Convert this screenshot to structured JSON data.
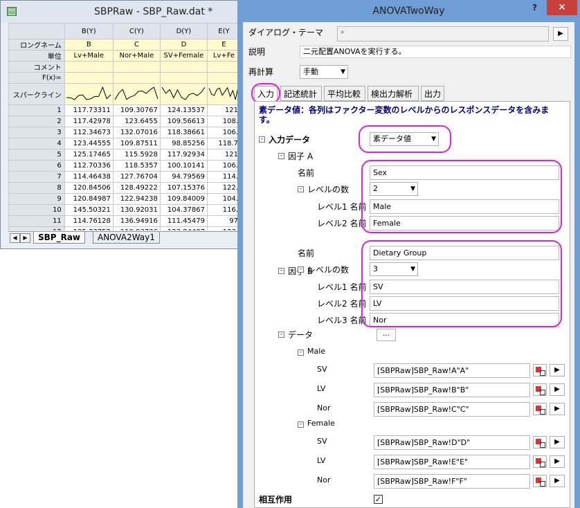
{
  "worksheet": {
    "title": "SBPRaw - SBP_Raw.dat *",
    "columns": [
      "B(Y)",
      "C(Y)",
      "D(Y)",
      "E(Y"
    ],
    "meta_labels": [
      "ロングネーム",
      "単位",
      "コメント",
      "F(x)=",
      "スパークライン"
    ],
    "long_names": [
      "B",
      "C",
      "D",
      "E"
    ],
    "units": [
      "Lv+Male",
      "Nor+Male",
      "SV+Female",
      "Lv+Fe"
    ],
    "rows": [
      {
        "n": "1",
        "v": [
          "117.73311",
          "109.30767",
          "124.13537",
          "121"
        ]
      },
      {
        "n": "2",
        "v": [
          "117.42978",
          "123.6455",
          "109.56613",
          "108."
        ]
      },
      {
        "n": "3",
        "v": [
          "112.34673",
          "132.07016",
          "118.38661",
          "106."
        ]
      },
      {
        "n": "4",
        "v": [
          "123.44555",
          "109.87511",
          "98.85256",
          "118.7"
        ]
      },
      {
        "n": "5",
        "v": [
          "125.17465",
          "115.5928",
          "117.92934",
          "121"
        ]
      },
      {
        "n": "6",
        "v": [
          "112.70336",
          "118.5357",
          "100.10141",
          "106."
        ]
      },
      {
        "n": "7",
        "v": [
          "114.46438",
          "127.76704",
          "94.79569",
          "114."
        ]
      },
      {
        "n": "8",
        "v": [
          "120.84506",
          "128.49222",
          "107.15376",
          "122."
        ]
      },
      {
        "n": "9",
        "v": [
          "120.84987",
          "122.94238",
          "109.84009",
          "104."
        ]
      },
      {
        "n": "10",
        "v": [
          "145.50321",
          "130.92031",
          "104.37867",
          "116."
        ]
      },
      {
        "n": "11",
        "v": [
          "114.76128",
          "136.94916",
          "111.45479",
          "97"
        ]
      },
      {
        "n": "12",
        "v": [
          "125.33752",
          "110.93736",
          "123.84407",
          "123."
        ]
      }
    ],
    "sheet_tabs": [
      "SBP_Raw",
      "ANOVA2Way1"
    ],
    "nav_buttons": [
      "◀",
      "▶"
    ]
  },
  "dialog": {
    "title": "ANOVATwoWay",
    "help": "?",
    "close": "✕",
    "theme_label": "ダイアログ・テーマ",
    "theme_value": "*",
    "theme_arrow": "▶",
    "desc_label": "説明",
    "desc_value": "二元配置ANOVAを実行する。",
    "recalc_label": "再計算",
    "recalc_value": "手動",
    "tabs": [
      "入力",
      "記述統計",
      "平均比較",
      "検出力解析",
      "出力"
    ],
    "info_text": "素データ値：各列はファクター変数のレベルからのレスポンスデータを含みます。",
    "input_data_label": "入力データ",
    "input_data_value": "素データ値",
    "factorA": {
      "label": "因子 A",
      "name_label": "名前",
      "name_value": "Sex",
      "levels_label": "レベルの数",
      "levels_value": "2",
      "level_names": [
        {
          "label": "レベル1 名前",
          "value": "Male"
        },
        {
          "label": "レベル2 名前",
          "value": "Female"
        }
      ]
    },
    "factorB": {
      "label": "因子 B",
      "name_label": "名前",
      "name_value": "Dietary Group",
      "levels_label": "レベルの数",
      "levels_value": "3",
      "level_names": [
        {
          "label": "レベル1 名前",
          "value": "SV"
        },
        {
          "label": "レベル2 名前",
          "value": "LV"
        },
        {
          "label": "レベル3 名前",
          "value": "Nor"
        }
      ]
    },
    "data_label": "データ",
    "data_button": "...",
    "groups": [
      {
        "label": "Male",
        "items": [
          {
            "label": "SV",
            "value": "[SBPRaw]SBP_Raw!A\"A\""
          },
          {
            "label": "LV",
            "value": "[SBPRaw]SBP_Raw!B\"B\""
          },
          {
            "label": "Nor",
            "value": "[SBPRaw]SBP_Raw!C\"C\""
          }
        ]
      },
      {
        "label": "Female",
        "items": [
          {
            "label": "SV",
            "value": "[SBPRaw]SBP_Raw!D\"D\""
          },
          {
            "label": "LV",
            "value": "[SBPRaw]SBP_Raw!E\"E\""
          },
          {
            "label": "Nor",
            "value": "[SBPRaw]SBP_Raw!F\"F\""
          }
        ]
      }
    ],
    "interaction_label": "相互作用",
    "interaction_checked": "✓",
    "colors": {
      "highlight": "#e020e0",
      "title_bg": "#6f9dd6",
      "close_bg": "#c7403a",
      "info_text": "#000080"
    }
  }
}
